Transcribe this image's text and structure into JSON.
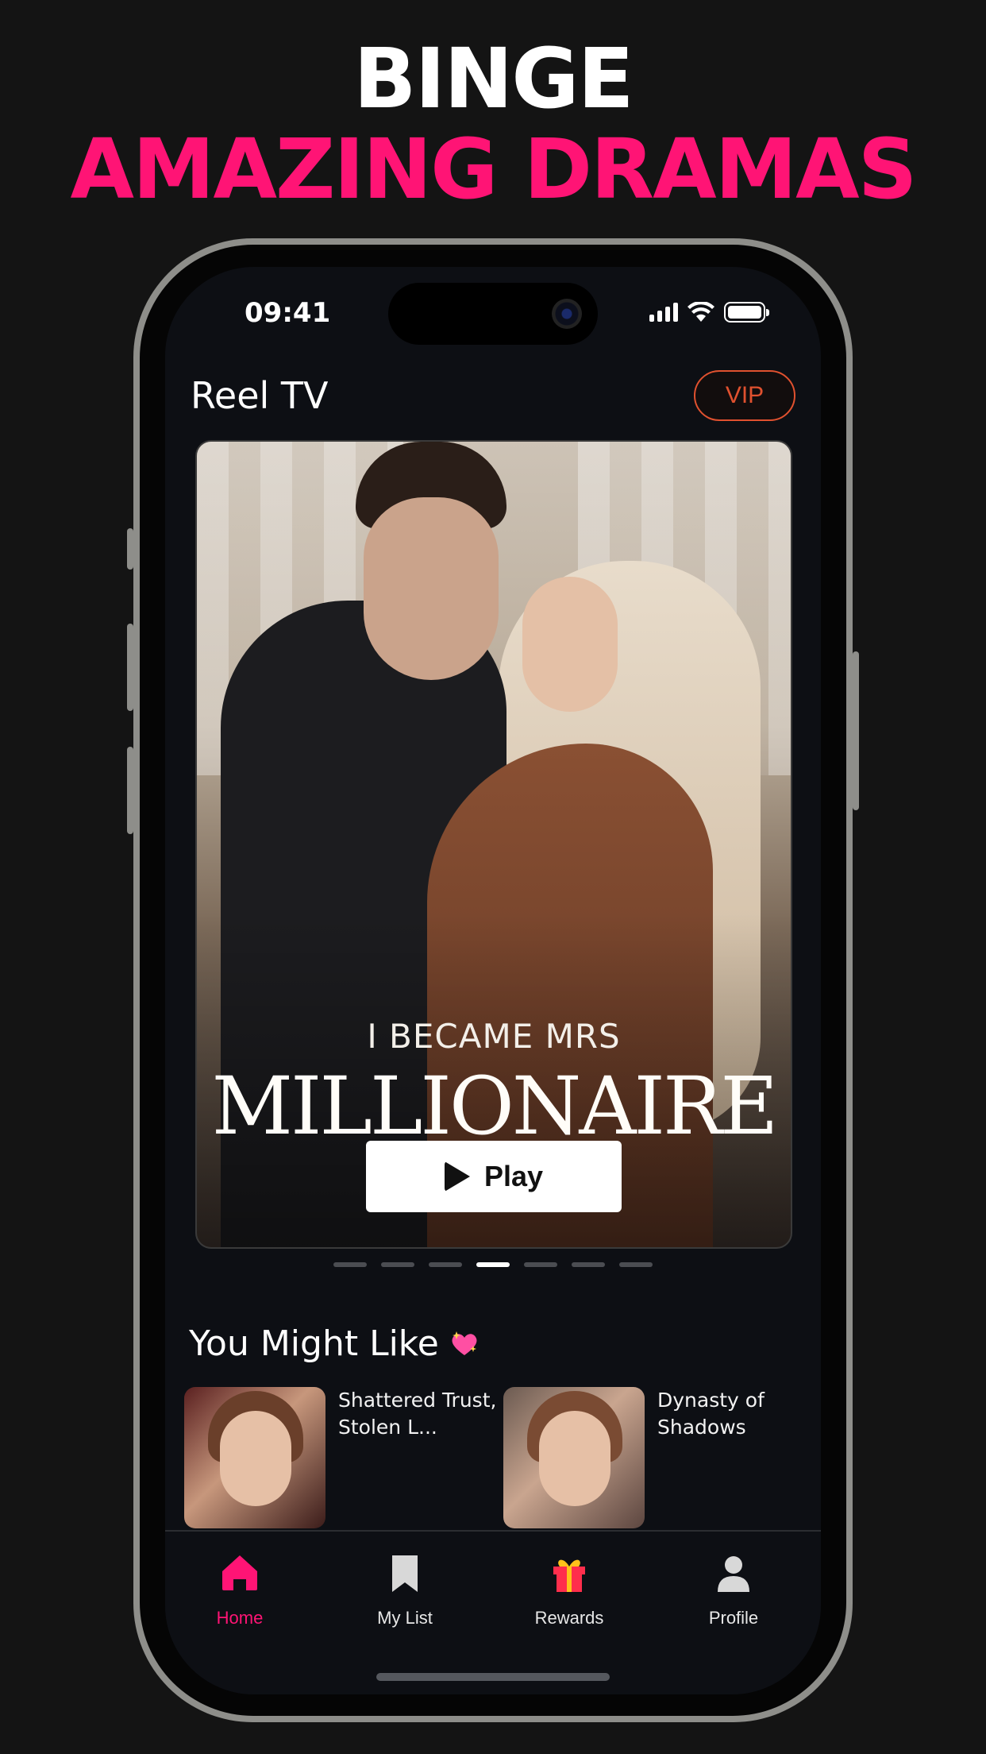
{
  "promo": {
    "line1": "BINGE",
    "line2": "AMAZING DRAMAS"
  },
  "status_bar": {
    "time": "09:41"
  },
  "header": {
    "app_title": "Reel TV",
    "vip_label": "VIP"
  },
  "hero": {
    "subtitle": "I BECAME MRS",
    "title": "MILLIONAIRE",
    "play_label": "Play",
    "carousel_count": 7,
    "carousel_active_index": 3
  },
  "recommendations": {
    "section_title": "You Might Like",
    "section_icon": "sparkling-heart-icon",
    "items": [
      {
        "title": "Shattered Trust, Stolen L..."
      },
      {
        "title": "Dynasty of Shadows"
      }
    ]
  },
  "tabbar": {
    "items": [
      {
        "label": "Home",
        "icon": "home-icon",
        "active": true
      },
      {
        "label": "My List",
        "icon": "bookmark-icon",
        "active": false
      },
      {
        "label": "Rewards",
        "icon": "gift-icon",
        "active": false
      },
      {
        "label": "Profile",
        "icon": "profile-icon",
        "active": false
      }
    ]
  },
  "colors": {
    "accent": "#ff1475",
    "vip": "#e0512f",
    "background": "#141414",
    "screen": "#0d0f14"
  }
}
